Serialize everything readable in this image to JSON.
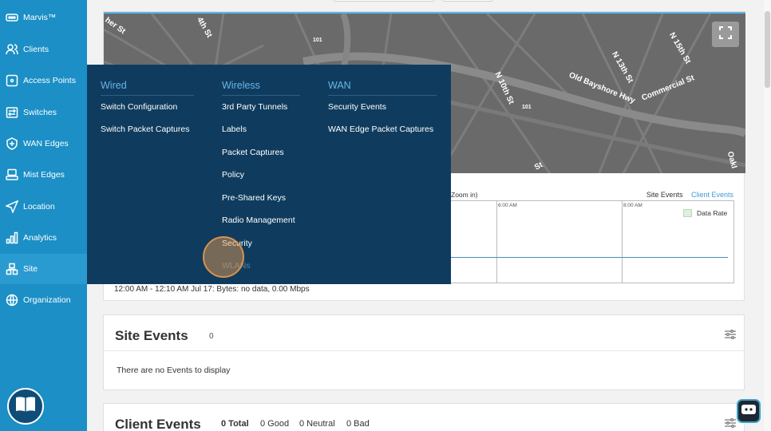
{
  "sidebar": {
    "items": [
      {
        "label": "Marvis™",
        "icon": "marvis-icon"
      },
      {
        "label": "Clients",
        "icon": "clients-icon"
      },
      {
        "label": "Access Points",
        "icon": "access-point-icon"
      },
      {
        "label": "Switches",
        "icon": "switch-icon"
      },
      {
        "label": "WAN Edges",
        "icon": "wan-edge-icon"
      },
      {
        "label": "Mist Edges",
        "icon": "mist-edge-icon"
      },
      {
        "label": "Location",
        "icon": "location-icon"
      },
      {
        "label": "Analytics",
        "icon": "analytics-icon"
      },
      {
        "label": "Site",
        "icon": "site-icon"
      },
      {
        "label": "Organization",
        "icon": "organization-icon"
      }
    ],
    "active": "Site",
    "help_icon": "book-icon"
  },
  "map": {
    "labels": [
      "her St",
      "4th St",
      "101",
      "N 15th St",
      "N 13th St",
      "Old Bayshore Hwy",
      "Commercial St",
      "N 10th St",
      "101",
      "St",
      "Oakl"
    ],
    "fullscreen_icon": "fullscreen-icon"
  },
  "chart": {
    "hint": "Zoom in)",
    "tabs": [
      "Site Events",
      "Client Events"
    ],
    "active_tab": "Client Events",
    "ticks": [
      "6:00 AM",
      "8:00 AM"
    ],
    "legend": "Data Rate",
    "bytes_text": "12:00 AM - 12:10 AM Jul 17: Bytes: no data, 0.00 Mbps"
  },
  "site_events": {
    "title": "Site Events",
    "count": "0",
    "empty_text": "There are no Events to display"
  },
  "client_events": {
    "title": "Client Events",
    "total": "0 Total",
    "good": "0 Good",
    "neutral": "0 Neutral",
    "bad": "0 Bad"
  },
  "menu": {
    "columns": [
      {
        "heading": "Wired",
        "items": [
          "Switch Configuration",
          "Switch Packet Captures"
        ]
      },
      {
        "heading": "Wireless",
        "items": [
          "3rd Party Tunnels",
          "Labels",
          "Packet Captures",
          "Policy",
          "Pre-Shared Keys",
          "Radio Management",
          "Security",
          "WLANs"
        ]
      },
      {
        "heading": "WAN",
        "items": [
          "Security Events",
          "WAN Edge Packet Captures"
        ]
      }
    ]
  },
  "colors": {
    "sidebar": "#1b8fc6",
    "menu": "#0f3c5e",
    "menu_heading": "#69b5e8",
    "link": "#3c9ad6"
  }
}
